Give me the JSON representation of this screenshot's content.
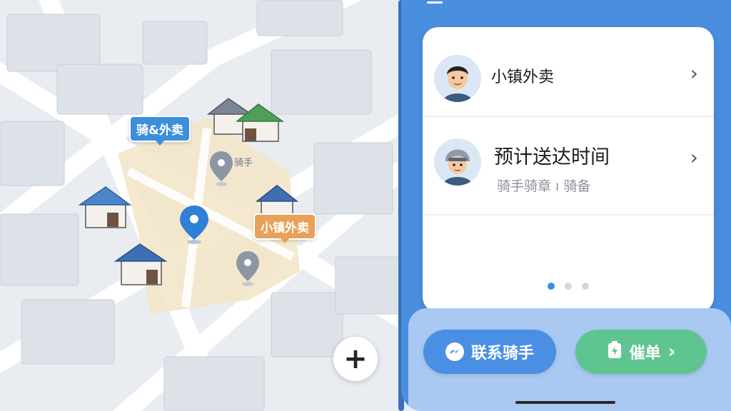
{
  "map": {
    "rider_label": "骑&外卖",
    "shop_label": "小镇外卖",
    "pin_text": "骑手",
    "zoom_in_label": "+"
  },
  "order_card": {
    "shop_row": {
      "title": "小镇外卖",
      "avatar_icon": "shop-owner-avatar"
    },
    "delivery_row": {
      "title": "预计送达时间",
      "subtitle": "骑手骑章 ı 骑备",
      "avatar_icon": "rider-avatar"
    },
    "pager": {
      "count": 3,
      "active": 1
    }
  },
  "actions": {
    "contact_rider": "联系骑手",
    "urge_order": "催单"
  },
  "colors": {
    "primary_blue": "#4a8ee0",
    "accent_green": "#5fc590",
    "accent_orange": "#e9a058"
  }
}
